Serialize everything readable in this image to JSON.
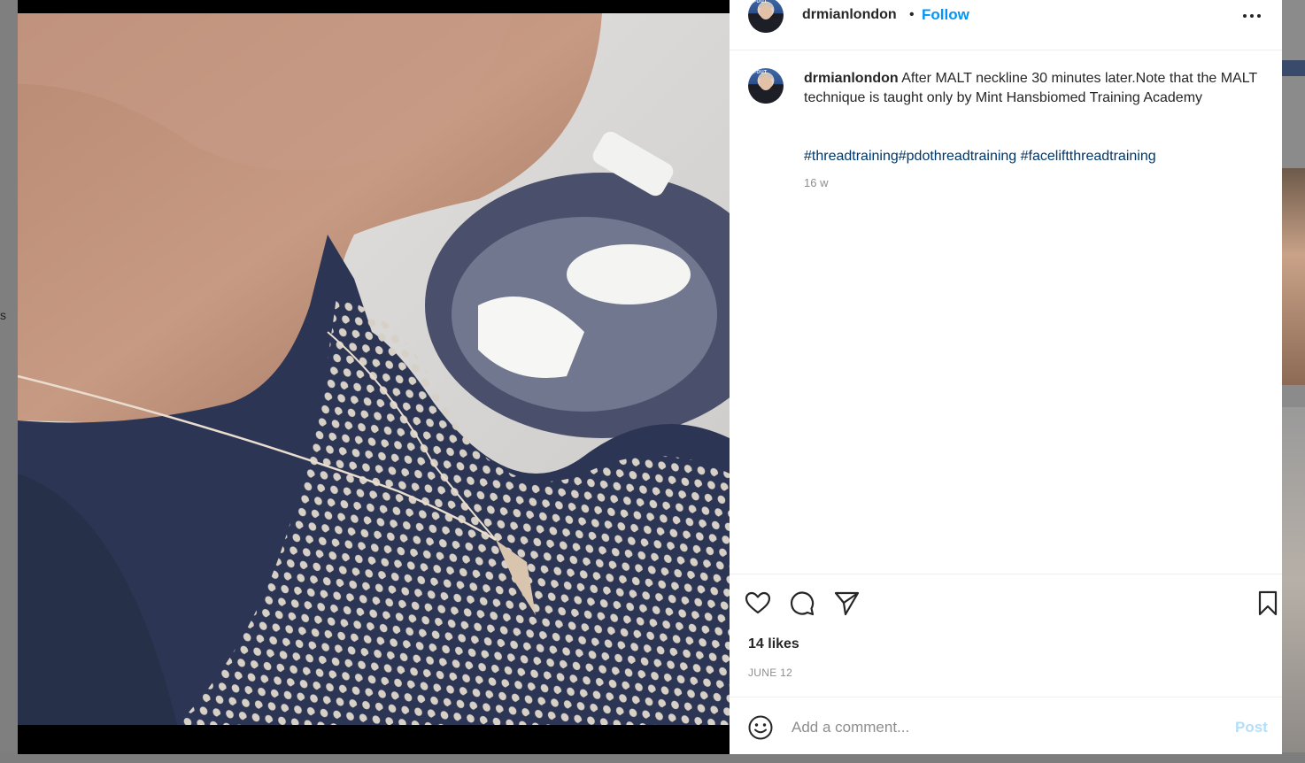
{
  "background": {
    "left_text": "s"
  },
  "post": {
    "header": {
      "username": "drmianlondon",
      "separator": "•",
      "follow_label": "Follow",
      "more_icon": "more-horizontal-icon"
    },
    "avatar_text": "FOUT",
    "caption": {
      "username": "drmianlondon",
      "text": "After MALT neckline 30 minutes later.Note that the MALT technique is taught only by Mint Hansbiomed Training Academy",
      "hashtags": [
        "#threadtraining",
        "#pdothreadtraining",
        "#faceliftthreadtraining"
      ],
      "time_ago": "16 w"
    },
    "actions": {
      "like_icon": "heart-icon",
      "comment_icon": "comment-icon",
      "share_icon": "paper-plane-icon",
      "save_icon": "bookmark-icon"
    },
    "likes": "14 likes",
    "date": "JUNE 12",
    "comment": {
      "emoji_icon": "smiley-icon",
      "placeholder": "Add a comment...",
      "value": "",
      "post_label": "Post"
    }
  },
  "colors": {
    "link_blue": "#0095f6",
    "hashtag_blue": "#00376b",
    "post_disabled": "#b2dffc",
    "text": "#262626",
    "muted": "#8e8e8e"
  }
}
